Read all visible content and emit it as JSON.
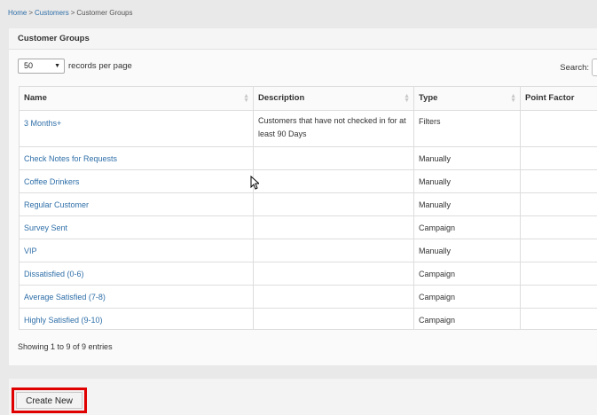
{
  "breadcrumb": {
    "home": "Home",
    "sep1": ">",
    "customers": "Customers",
    "sep2": ">",
    "current": "Customer Groups"
  },
  "panel": {
    "title": "Customer Groups"
  },
  "controls": {
    "page_length": "50",
    "page_length_label": "records per page",
    "search_label": "Search:"
  },
  "table": {
    "columns": [
      "Name",
      "Description",
      "Type",
      "Point Factor"
    ],
    "rows": [
      {
        "name": "3 Months+",
        "description": "Customers that have not checked in for at least 90 Days",
        "type": "Filters",
        "point_factor": ""
      },
      {
        "name": "Check Notes for Requests",
        "description": "",
        "type": "Manually",
        "point_factor": ""
      },
      {
        "name": "Coffee Drinkers",
        "description": "",
        "type": "Manually",
        "point_factor": ""
      },
      {
        "name": "Regular Customer",
        "description": "",
        "type": "Manually",
        "point_factor": ""
      },
      {
        "name": "Survey Sent",
        "description": "",
        "type": "Campaign",
        "point_factor": ""
      },
      {
        "name": "VIP",
        "description": "",
        "type": "Manually",
        "point_factor": ""
      },
      {
        "name": "Dissatisfied (0-6)",
        "description": "",
        "type": "Campaign",
        "point_factor": ""
      },
      {
        "name": "Average Satisfied (7-8)",
        "description": "",
        "type": "Campaign",
        "point_factor": ""
      },
      {
        "name": "Highly Satisfied (9-10)",
        "description": "",
        "type": "Campaign",
        "point_factor": ""
      }
    ]
  },
  "info": "Showing 1 to 9 of 9 entries",
  "actions": {
    "create_new": "Create New"
  },
  "colors": {
    "link": "#2f6fa8",
    "highlight": "#e00000"
  }
}
